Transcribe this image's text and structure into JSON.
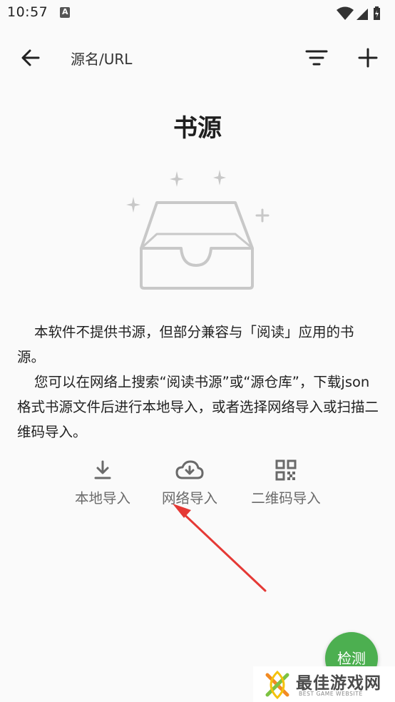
{
  "status_bar": {
    "time": "10:57",
    "icons": [
      "app-notification-icon",
      "wifi-icon",
      "signal-icon",
      "battery-icon"
    ]
  },
  "toolbar": {
    "title": "源名/URL",
    "back_icon": "arrow-left-icon",
    "filter_icon": "filter-icon",
    "add_icon": "plus-icon"
  },
  "page": {
    "title": "书源",
    "illustration": "empty-inbox-icon",
    "description_1": "本软件不提供书源，但部分兼容与「阅读」应用的书源。",
    "description_2": "您可以在网络上搜索“阅读书源”或“源仓库”，下载json格式书源文件后进行本地导入，或者选择网络导入或扫描二维码导入。"
  },
  "imports": {
    "local": {
      "label": "本地导入",
      "icon": "download-icon"
    },
    "network": {
      "label": "网络导入",
      "icon": "cloud-download-icon"
    },
    "qrcode": {
      "label": "二维码导入",
      "icon": "qr-code-icon"
    }
  },
  "fab": {
    "label": "检测"
  },
  "watermark": {
    "title": "最佳游戏网",
    "subtitle": "BEST GAME WEBSITE"
  },
  "colors": {
    "fab": "#4caf50",
    "annotation_arrow": "#e53935",
    "background": "#fafafa",
    "icon_gray": "#6a6a6a"
  }
}
